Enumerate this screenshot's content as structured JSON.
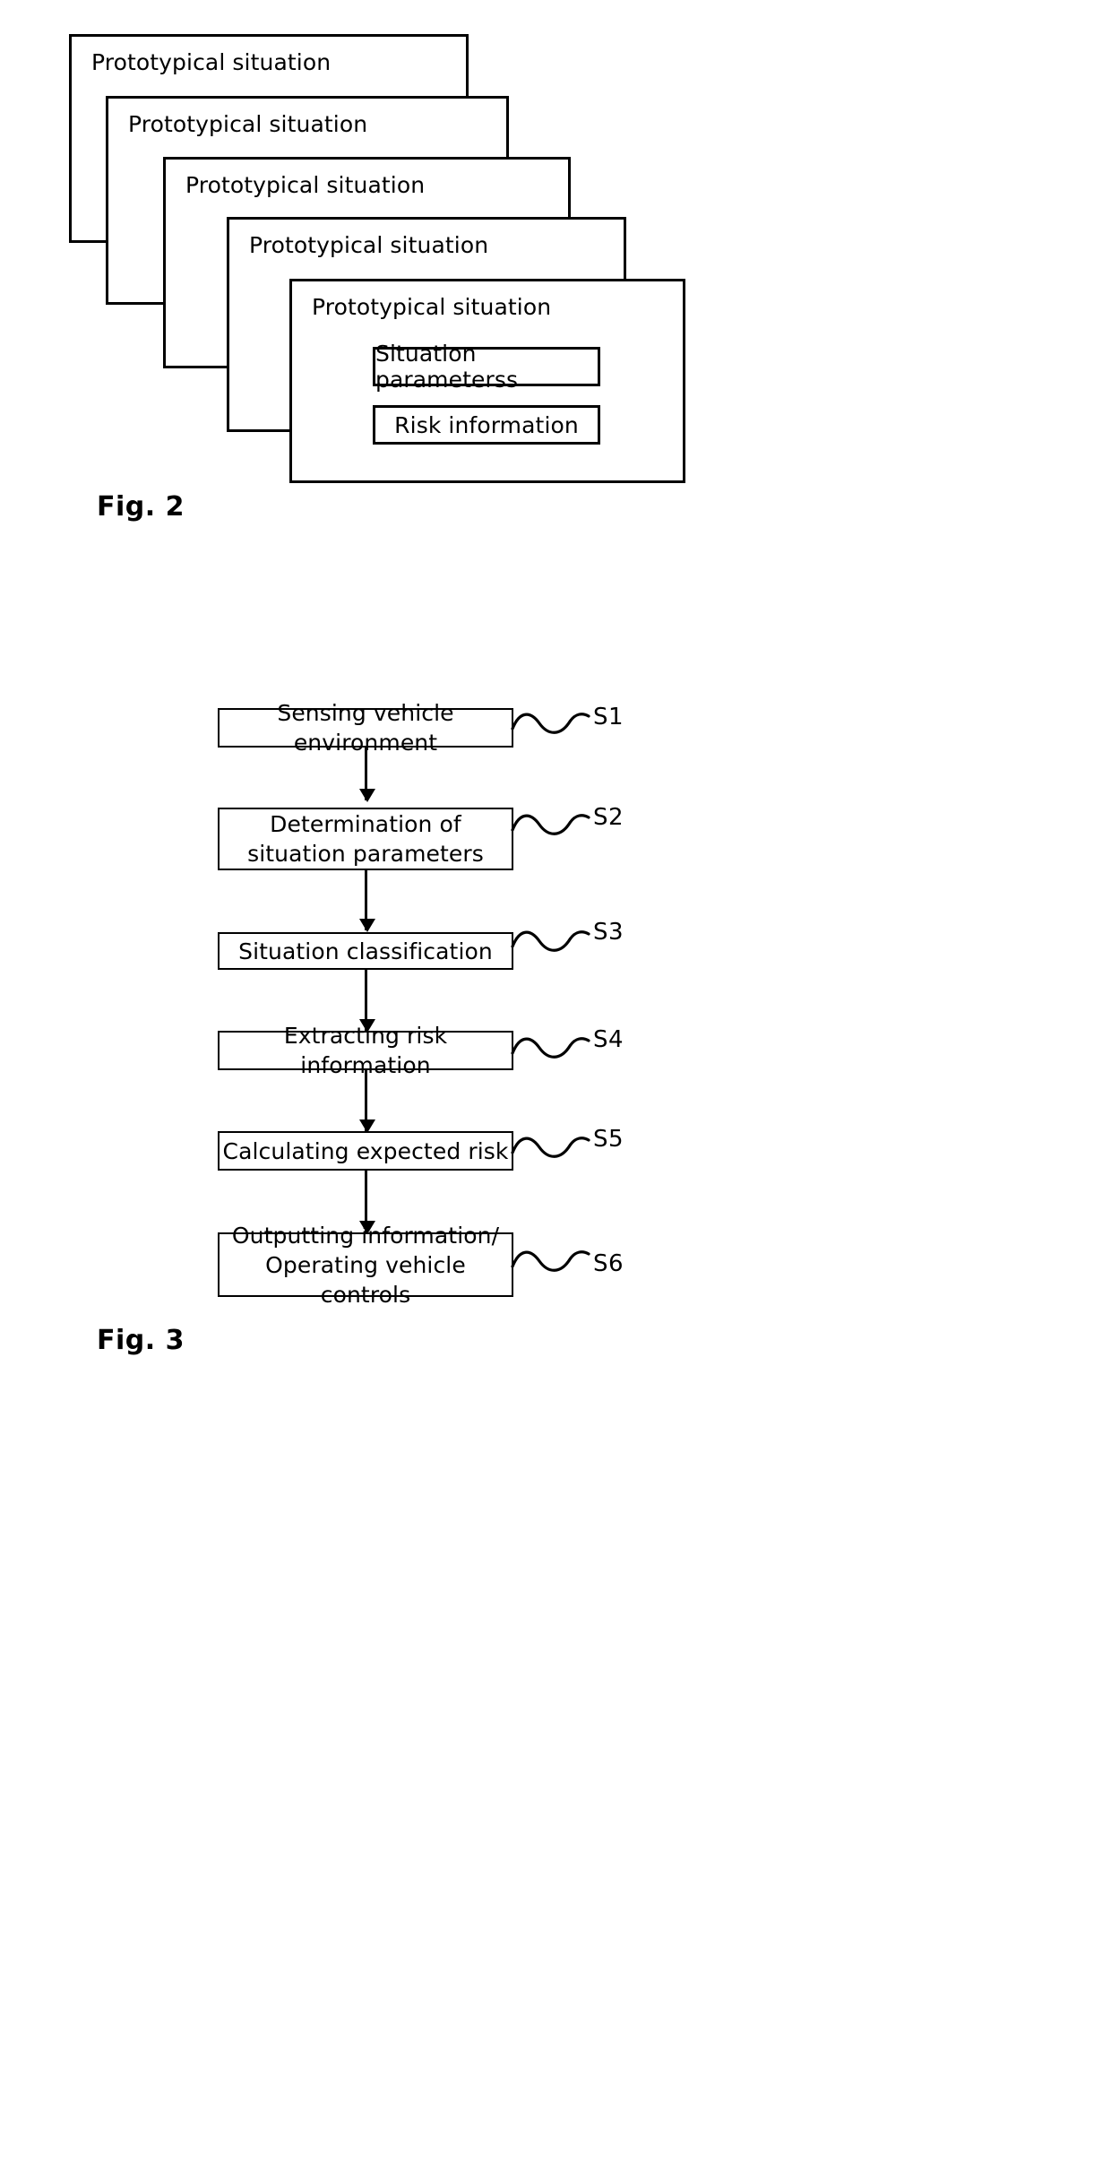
{
  "figure2": {
    "caption": "Fig. 2",
    "cards": [
      {
        "title": "Prototypical situation"
      },
      {
        "title": "Prototypical situation"
      },
      {
        "title": "Prototypical situation"
      },
      {
        "title": "Prototypical situation"
      },
      {
        "title": "Prototypical situation"
      }
    ],
    "front_card_items": [
      {
        "label": "Situation parameterss"
      },
      {
        "label": "Risk information"
      }
    ]
  },
  "figure3": {
    "caption": "Fig. 3",
    "steps": [
      {
        "label": "Sensing vehicle environment",
        "tag": "S1"
      },
      {
        "label": "Determination of situation parameters",
        "tag": "S2"
      },
      {
        "label": "Situation classification",
        "tag": "S3"
      },
      {
        "label": "Extracting risk information",
        "tag": "S4"
      },
      {
        "label": "Calculating expected risk",
        "tag": "S5"
      },
      {
        "label": "Outputting information/ Operating vehicle controls",
        "tag": "S6"
      }
    ]
  },
  "colors": {
    "line": "#000000",
    "background": "#ffffff"
  }
}
